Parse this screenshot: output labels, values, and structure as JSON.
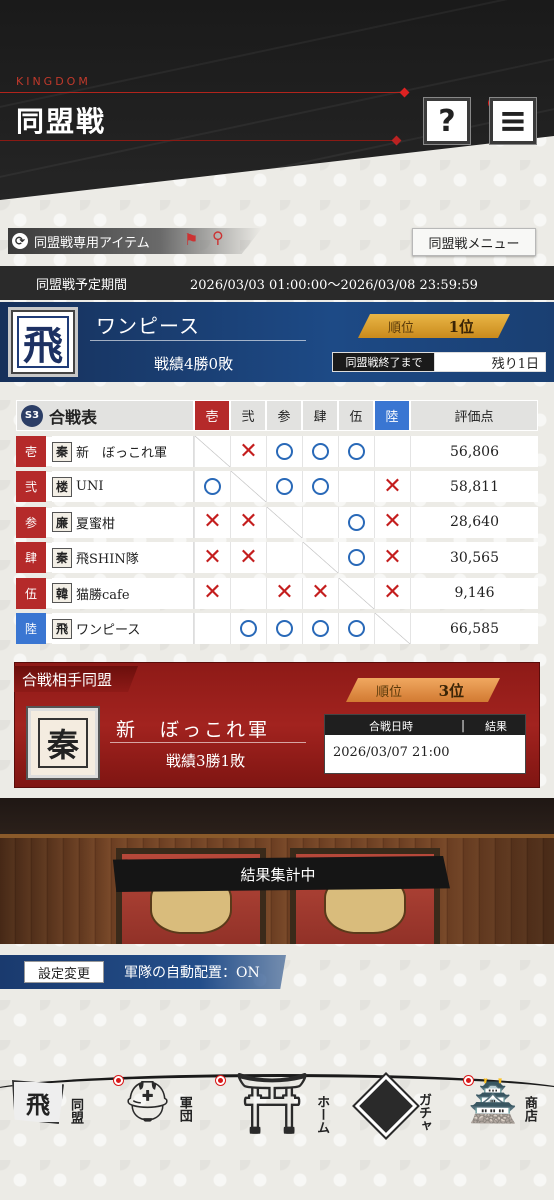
{
  "header": {
    "brand": "KINGDOM",
    "title": "同盟戦",
    "help_label": "?",
    "menu_label": "≡"
  },
  "toolbar": {
    "item_button": "同盟戦専用アイテム",
    "menu_button": "同盟戦メニュー"
  },
  "period": {
    "label": "同盟戦予定期間",
    "value": "2026/03/03 01:00:00～2026/03/08 23:59:59"
  },
  "own": {
    "crest_char": "飛",
    "name": "ワンピース",
    "record": "戦績4勝0敗",
    "rank_label": "順位",
    "rank_value": "1位",
    "end_label": "同盟戦終了まで",
    "remaining": "残り1日"
  },
  "table": {
    "season": "S3",
    "title": "合戦表",
    "columns": [
      "壱",
      "弐",
      "参",
      "肆",
      "伍",
      "陸"
    ],
    "score_header": "評価点",
    "rows": [
      {
        "num": "壱",
        "icon": "秦",
        "name": "新　ぼっこれ軍",
        "marks": [
          "-",
          "x",
          "o",
          "o",
          "o",
          ""
        ],
        "score": "56,806"
      },
      {
        "num": "弐",
        "icon": "楼",
        "name": "UNI",
        "marks": [
          "o",
          "-",
          "o",
          "o",
          "",
          "x"
        ],
        "score": "58,811"
      },
      {
        "num": "参",
        "icon": "廉",
        "name": "夏蜜柑",
        "marks": [
          "x",
          "x",
          "-",
          "",
          "o",
          "x"
        ],
        "score": "28,640"
      },
      {
        "num": "肆",
        "icon": "秦",
        "name": "飛SHIN隊",
        "marks": [
          "x",
          "x",
          "",
          "-",
          "o",
          "x"
        ],
        "score": "30,565"
      },
      {
        "num": "伍",
        "icon": "韓",
        "name": "猫勝cafe",
        "marks": [
          "x",
          "",
          "x",
          "x",
          "-",
          "x"
        ],
        "score": "9,146"
      },
      {
        "num": "陸",
        "icon": "飛",
        "name": "ワンピース",
        "marks": [
          "",
          "o",
          "o",
          "o",
          "o",
          "-"
        ],
        "score": "66,585"
      }
    ],
    "colors": {
      "red": "#b52a2a",
      "blue": "#3a76d2",
      "circle": "#2969b8",
      "cross": "#c41e1e"
    }
  },
  "opponent": {
    "title": "合戦相手同盟",
    "crest_char": "秦",
    "name": "新　ぼっこれ軍",
    "record": "戦績3勝1敗",
    "rank_label": "順位",
    "rank_value": "3位",
    "date_header": "合戦日時",
    "result_header": "結果",
    "date": "2026/03/07 21:00",
    "result": ""
  },
  "result": {
    "banner": "結果集計中"
  },
  "settings": {
    "button": "設定変更",
    "value": "軍隊の自動配置：ON"
  },
  "nav": {
    "alliance": {
      "glyph": "飛",
      "label": "同盟"
    },
    "army": {
      "glyph": "helmet-icon",
      "label": "軍団"
    },
    "home": {
      "glyph": "castle-icon",
      "label": "ホーム"
    },
    "gacha": {
      "glyph": "gacha-icon",
      "label": "ガチャ"
    },
    "shop": {
      "glyph": "shop-icon",
      "label": "商店"
    }
  }
}
